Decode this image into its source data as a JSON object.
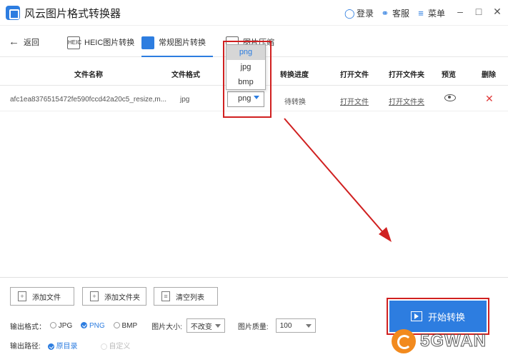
{
  "app": {
    "title": "风云图片格式转换器"
  },
  "titlebar": {
    "login": "登录",
    "service": "客服",
    "menu": "菜单"
  },
  "tabs": {
    "back": "返回",
    "items": [
      {
        "label": "HEIC图片转换",
        "icon_text": "HEIC"
      },
      {
        "label": "常规图片转换"
      },
      {
        "label": "图片压缩"
      }
    ]
  },
  "table": {
    "headers": [
      "文件名称",
      "文件格式",
      "转换进度",
      "打开文件",
      "打开文件夹",
      "预览",
      "删除"
    ],
    "rows": [
      {
        "filename": "afc1ea8376515472fe590fccd42a20c5_resize,m...",
        "format": "jpg",
        "target": "png",
        "status": "待转换",
        "open_file": "打开文件",
        "open_folder": "打开文件夹"
      }
    ]
  },
  "dropdown": {
    "options": [
      "png",
      "jpg",
      "bmp"
    ],
    "selected": "png"
  },
  "bottom": {
    "add_file": "添加文件",
    "add_folder": "添加文件夹",
    "clear_list": "清空列表",
    "output_format_label": "输出格式：",
    "formats": [
      "JPG",
      "PNG",
      "BMP"
    ],
    "selected_format": "PNG",
    "size_label": "图片大小:",
    "size_value": "不改变",
    "quality_label": "图片质量:",
    "quality_value": "100",
    "output_path_label": "输出路径:",
    "path_original": "原目录",
    "path_custom": "自定义",
    "start": "开始转换"
  },
  "watermark": {
    "text": "5GWAN"
  },
  "colors": {
    "accent": "#2d7de0",
    "annotation": "#d02020",
    "delete": "#e03a3a",
    "watermark": "#f28a1e"
  }
}
